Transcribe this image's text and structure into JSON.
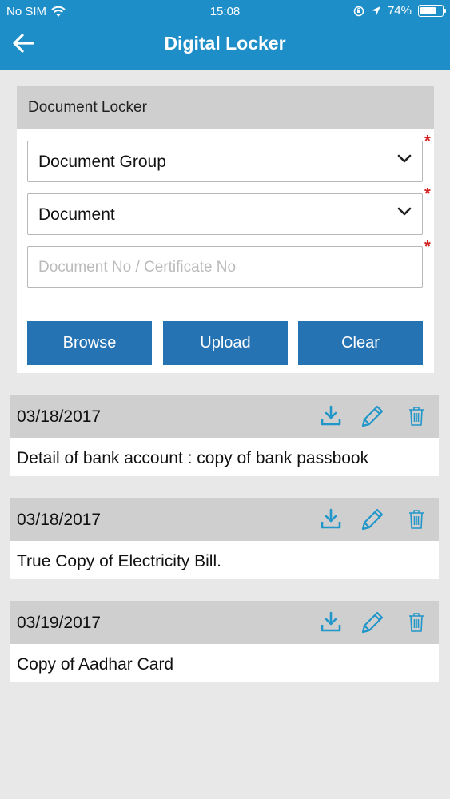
{
  "status": {
    "carrier": "No SIM",
    "time": "15:08",
    "battery": "74%",
    "battery_level": 0.74
  },
  "nav": {
    "title": "Digital Locker",
    "back_icon": "arrow-left-icon"
  },
  "card": {
    "title": "Document Locker",
    "document_group": {
      "value": "Document Group",
      "required": "*"
    },
    "document": {
      "value": "Document",
      "required": "*"
    },
    "doc_number": {
      "placeholder": "Document No / Certificate No",
      "required": "*"
    },
    "buttons": {
      "browse": "Browse",
      "upload": "Upload",
      "clear": "Clear"
    }
  },
  "documents": [
    {
      "date": "03/18/2017",
      "description": "Detail of bank account : copy of bank passbook"
    },
    {
      "date": "03/18/2017",
      "description": "True Copy of Electricity Bill."
    },
    {
      "date": "03/19/2017",
      "description": "Copy of Aadhar Card"
    }
  ],
  "colors": {
    "header": "#1e8ec8",
    "button": "#2673b4",
    "icon": "#2196c9",
    "required": "#d32020"
  }
}
